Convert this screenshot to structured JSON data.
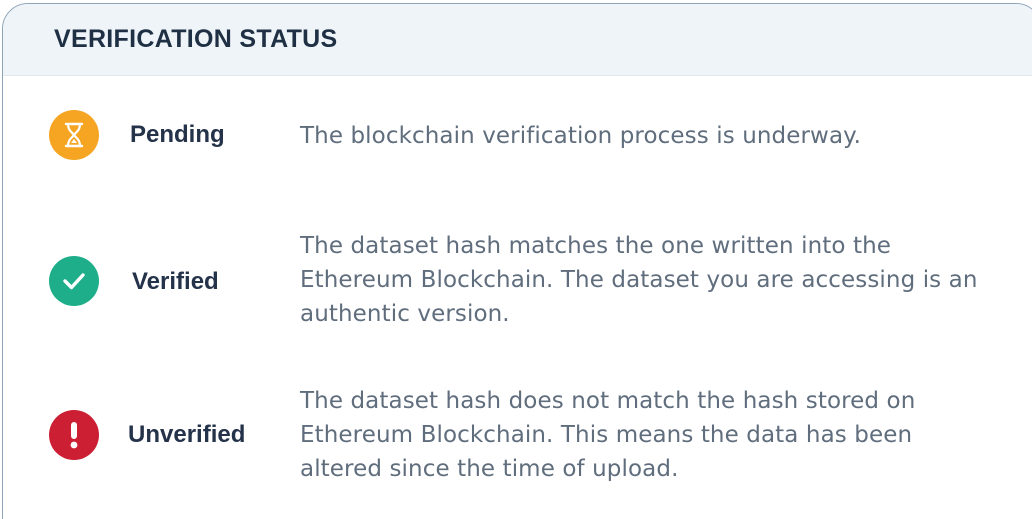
{
  "panel": {
    "title": "VERIFICATION STATUS"
  },
  "statuses": [
    {
      "label": "Pending",
      "description": "The blockchain verification process is underway.",
      "icon": "hourglass-icon",
      "color": "#f5a522"
    },
    {
      "label": "Verified",
      "description": "The dataset hash matches the one written into the Ethereum Blockchain. The dataset you are accessing is an authentic version.",
      "icon": "checkmark-icon",
      "color": "#1fae8a"
    },
    {
      "label": "Unverified",
      "description": "The dataset hash does not match the hash stored on Ethereum Blockchain. This means the data has been altered since the time of upload.",
      "icon": "exclamation-icon",
      "color": "#cc1f33"
    }
  ]
}
